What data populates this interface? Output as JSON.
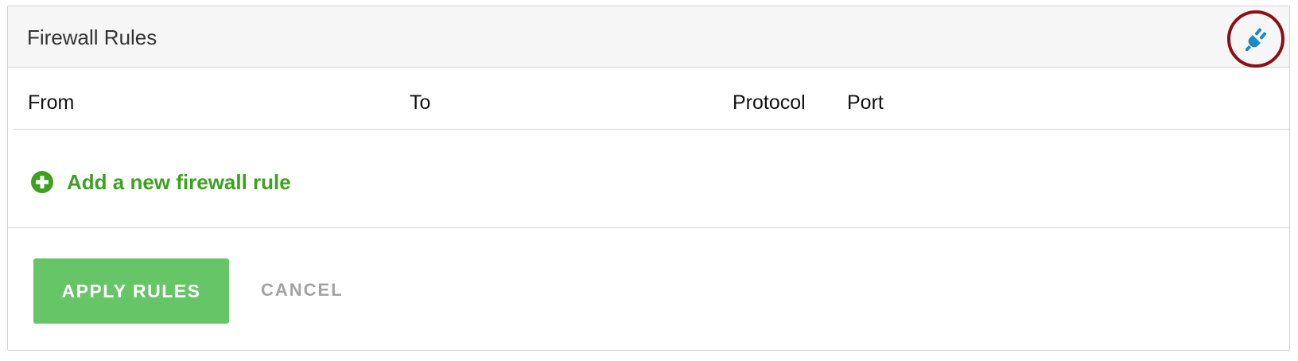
{
  "panel": {
    "title": "Firewall Rules",
    "header_icon": "plug-icon",
    "header_icon_color": "#1e88c7",
    "highlight_ring_color": "#8b0f16"
  },
  "table": {
    "columns": [
      "From",
      "To",
      "Protocol",
      "Port"
    ]
  },
  "add_rule": {
    "icon": "plus-circle-icon",
    "label": "Add a new firewall rule",
    "color": "#3da11f"
  },
  "actions": {
    "apply_label": "APPLY RULES",
    "apply_color": "#66c566",
    "cancel_label": "CANCEL"
  }
}
